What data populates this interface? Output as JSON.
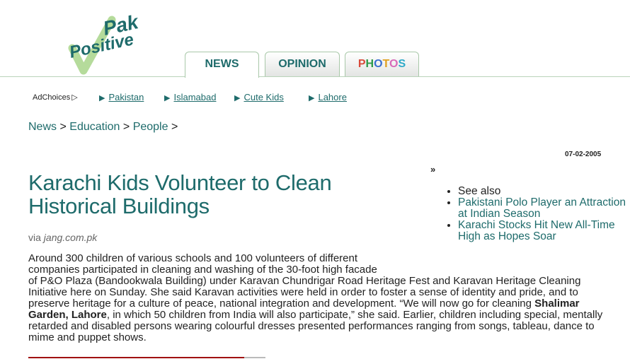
{
  "logo": {
    "pak": "Pak",
    "positive": "Positive"
  },
  "tabs": [
    {
      "label": "NEWS"
    },
    {
      "label": "OPINION"
    },
    {
      "label": "PHOTOS",
      "letters": [
        "P",
        "H",
        "O",
        "T",
        "O",
        "S"
      ],
      "letter_colors": [
        "#d94a3a",
        "#2e9a4a",
        "#3a6fd0",
        "#e0a020",
        "#d86ab8",
        "#2eaac8"
      ]
    }
  ],
  "adchoices": {
    "label": "AdChoices",
    "icon": "adchoices-icon"
  },
  "ad_links": [
    {
      "arrow": "▶",
      "label": "Pakistan"
    },
    {
      "arrow": "▶",
      "label": "Islamabad"
    },
    {
      "arrow": "▶",
      "label": "Cute Kids"
    },
    {
      "arrow": "▶",
      "label": "Lahore"
    }
  ],
  "breadcrumb": {
    "items": [
      "News",
      "Education",
      "People"
    ],
    "separator": ">"
  },
  "date": "07-02-2005",
  "raquo": "»",
  "article": {
    "title": "Karachi Kids Volunteer to Clean Historical Buildings",
    "via_prefix": "via",
    "source": "jang.com.pk",
    "line1": "Around 300 children of various schools and 100 volunteers of different",
    "line2": "companies participated in cleaning and washing of the 30-foot high facade",
    "line3": "of P&O Plaza (Bandookwala Building) under Karavan Chundrigar Road Heritage Fest and Karavan Heritage Cleaning Initiative here on Sunday. She said Karavan activities were held in order to foster a sense of identity and pride, and to preserve heritage for a culture of peace, national integration and development. “We will now go for cleaning",
    "bold": "Shalimar Garden, Lahore",
    "line4": ", in which 50 children from India will also participate,” she said. Earlier, children including special, mentally retarded and disabled persons wearing colourful dresses presented performances ranging from songs, tableau, dance to mime and puppet shows."
  },
  "related": {
    "see_also": "See also",
    "links": [
      "Pakistani Polo Player an Attraction at Indian Season",
      "Karachi Stocks Hit New All-Time High as Hopes Soar"
    ]
  },
  "colors": {
    "teal": "#1e6b6b",
    "green": "#7cb342",
    "divider_red": "#a01010"
  }
}
